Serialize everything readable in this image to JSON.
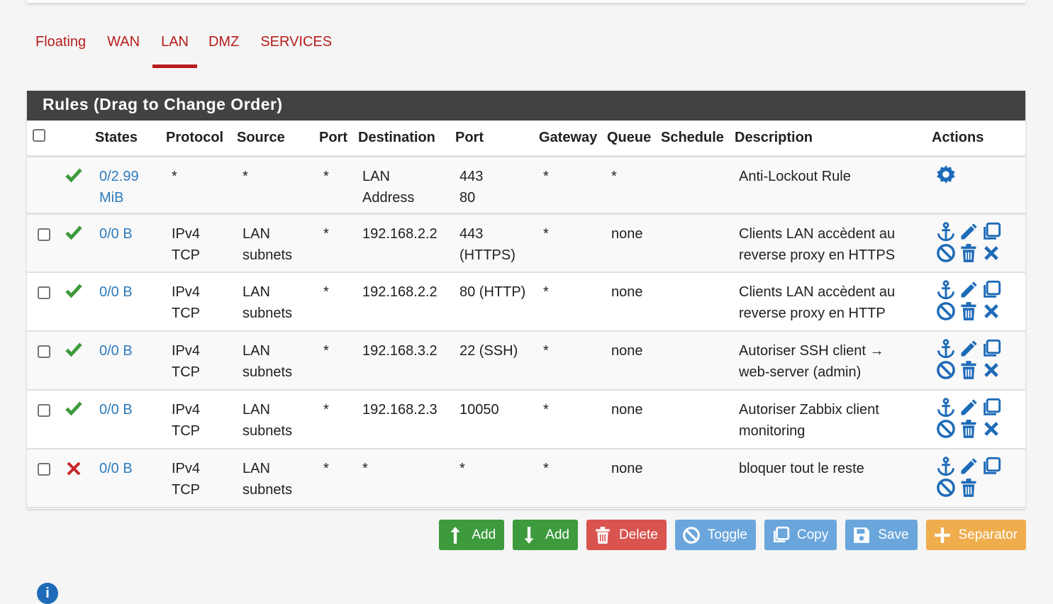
{
  "tabs": [
    {
      "label": "Floating"
    },
    {
      "label": "WAN"
    },
    {
      "label": "LAN",
      "active": true
    },
    {
      "label": "DMZ"
    },
    {
      "label": "SERVICES"
    }
  ],
  "panel": {
    "title": "Rules (Drag to Change Order)"
  },
  "columns": [
    "States",
    "Protocol",
    "Source",
    "Port",
    "Destination",
    "Port",
    "Gateway",
    "Queue",
    "Schedule",
    "Description",
    "Actions"
  ],
  "rules": [
    {
      "status": "pass",
      "states": [
        "0/2.99",
        "MiB"
      ],
      "protocol": [
        "*",
        ""
      ],
      "source": [
        "*",
        ""
      ],
      "sport": "*",
      "dest": [
        "LAN",
        "Address"
      ],
      "dport": [
        "443",
        "80"
      ],
      "gateway": "*",
      "queue": "*",
      "schedule": "",
      "desc": [
        "Anti-Lockout Rule",
        ""
      ]
    },
    {
      "status": "pass",
      "states": [
        "0/0 B",
        ""
      ],
      "protocol": [
        "IPv4",
        "TCP"
      ],
      "source": [
        "LAN",
        "subnets"
      ],
      "sport": "*",
      "dest": [
        "192.168.2.2",
        ""
      ],
      "dport": [
        "443",
        "(HTTPS)"
      ],
      "gateway": "*",
      "queue": "none",
      "schedule": "",
      "desc": [
        "Clients LAN accèdent au",
        "reverse proxy en HTTPS"
      ]
    },
    {
      "status": "pass",
      "states": [
        "0/0 B",
        ""
      ],
      "protocol": [
        "IPv4",
        "TCP"
      ],
      "source": [
        "LAN",
        "subnets"
      ],
      "sport": "*",
      "dest": [
        "192.168.2.2",
        ""
      ],
      "dport": [
        "80 (HTTP)",
        ""
      ],
      "gateway": "*",
      "queue": "none",
      "schedule": "",
      "desc": [
        "Clients LAN accèdent au",
        "reverse proxy en HTTP"
      ]
    },
    {
      "status": "pass",
      "states": [
        "0/0 B",
        ""
      ],
      "protocol": [
        "IPv4",
        "TCP"
      ],
      "source": [
        "LAN",
        "subnets"
      ],
      "sport": "*",
      "dest": [
        "192.168.3.2",
        ""
      ],
      "dport": [
        "22 (SSH)",
        ""
      ],
      "gateway": "*",
      "queue": "none",
      "schedule": "",
      "desc": [
        "Autoriser SSH client →",
        "web-server (admin)"
      ]
    },
    {
      "status": "pass",
      "states": [
        "0/0 B",
        ""
      ],
      "protocol": [
        "IPv4",
        "TCP"
      ],
      "source": [
        "LAN",
        "subnets"
      ],
      "sport": "*",
      "dest": [
        "192.168.2.3",
        ""
      ],
      "dport": [
        "10050",
        ""
      ],
      "gateway": "*",
      "queue": "none",
      "schedule": "",
      "desc": [
        "Autoriser Zabbix client",
        "monitoring"
      ]
    },
    {
      "status": "block",
      "states": [
        "0/0 B",
        ""
      ],
      "protocol": [
        "IPv4",
        "TCP"
      ],
      "source": [
        "LAN",
        "subnets"
      ],
      "sport": "*",
      "dest": [
        "*",
        ""
      ],
      "dport": [
        "*",
        ""
      ],
      "gateway": "*",
      "queue": "none",
      "schedule": "",
      "desc": [
        "bloquer tout le reste",
        ""
      ]
    }
  ],
  "buttons": {
    "add_top": "Add",
    "add_bottom": "Add",
    "delete": "Delete",
    "toggle": "Toggle",
    "copy": "Copy",
    "save": "Save",
    "separator": "Separator"
  },
  "colors": {
    "accent": "#b71c1c",
    "link": "#2d7bbd",
    "pass": "#3d9a3d",
    "block": "#c62828"
  }
}
